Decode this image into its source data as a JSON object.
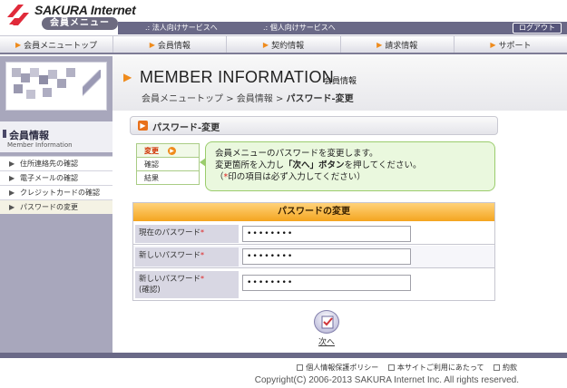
{
  "header": {
    "brand": "SAKURA Internet",
    "brand_sub": "会員メニュー",
    "corp_link": ".: 法人向けサービスへ",
    "personal_link": ".: 個人向けサービスへ",
    "logout": "ログアウト"
  },
  "nav": [
    {
      "label": "会員メニュートップ",
      "icon": "arrow-icon"
    },
    {
      "label": "会員情報",
      "icon": "arrow-icon"
    },
    {
      "label": "契約情報",
      "icon": "arrow-icon"
    },
    {
      "label": "請求情報",
      "icon": "arrow-icon"
    },
    {
      "label": "サポート",
      "icon": "arrow-icon"
    }
  ],
  "sidebar": {
    "title": "会員情報",
    "title_en": "Member Information",
    "items": [
      {
        "label": "住所連絡先の確認"
      },
      {
        "label": "電子メールの確認"
      },
      {
        "label": "クレジットカードの確認"
      },
      {
        "label": "パスワードの変更"
      }
    ]
  },
  "page": {
    "title": "MEMBER INFORMATION",
    "title_jp": "会員情報",
    "breadcrumb": [
      "会員メニュートップ",
      "会員情報",
      "パスワード-変更"
    ],
    "section_title": "パスワード-変更"
  },
  "steps": [
    {
      "label": "変更"
    },
    {
      "label": "確認"
    },
    {
      "label": "結果"
    }
  ],
  "info": {
    "line1": "会員メニューのパスワードを変更します。",
    "line2_pre": "変更箇所を入力し",
    "line2_bold": "「次へ」ボタン",
    "line2_post": "を押してください。",
    "line3_pre": "（",
    "line3_star": "*",
    "line3_post": "印の項目は必ず入力してください）"
  },
  "form": {
    "heading": "パスワードの変更",
    "rows": [
      {
        "label": "現在のパスワード",
        "value": "••••••••"
      },
      {
        "label": "新しいパスワード",
        "value": "••••••••"
      },
      {
        "label": "新しいパスワード",
        "label2": "(確認)",
        "value": "••••••••"
      }
    ],
    "required_mark": "*"
  },
  "next_button": "次へ",
  "footer": {
    "links": [
      "個人情報保護ポリシー",
      "本サイトご利用にあたって",
      "約款"
    ],
    "copyright": "Copyright(C) 2006-2013 SAKURA Internet Inc. All rights reserved."
  },
  "colors": {
    "header_bar": "#6a6987",
    "sidebar": "#a8a7bc",
    "accent": "#ef8b1c",
    "info_bg": "#eaf8de",
    "form_head": "#f4a520"
  }
}
